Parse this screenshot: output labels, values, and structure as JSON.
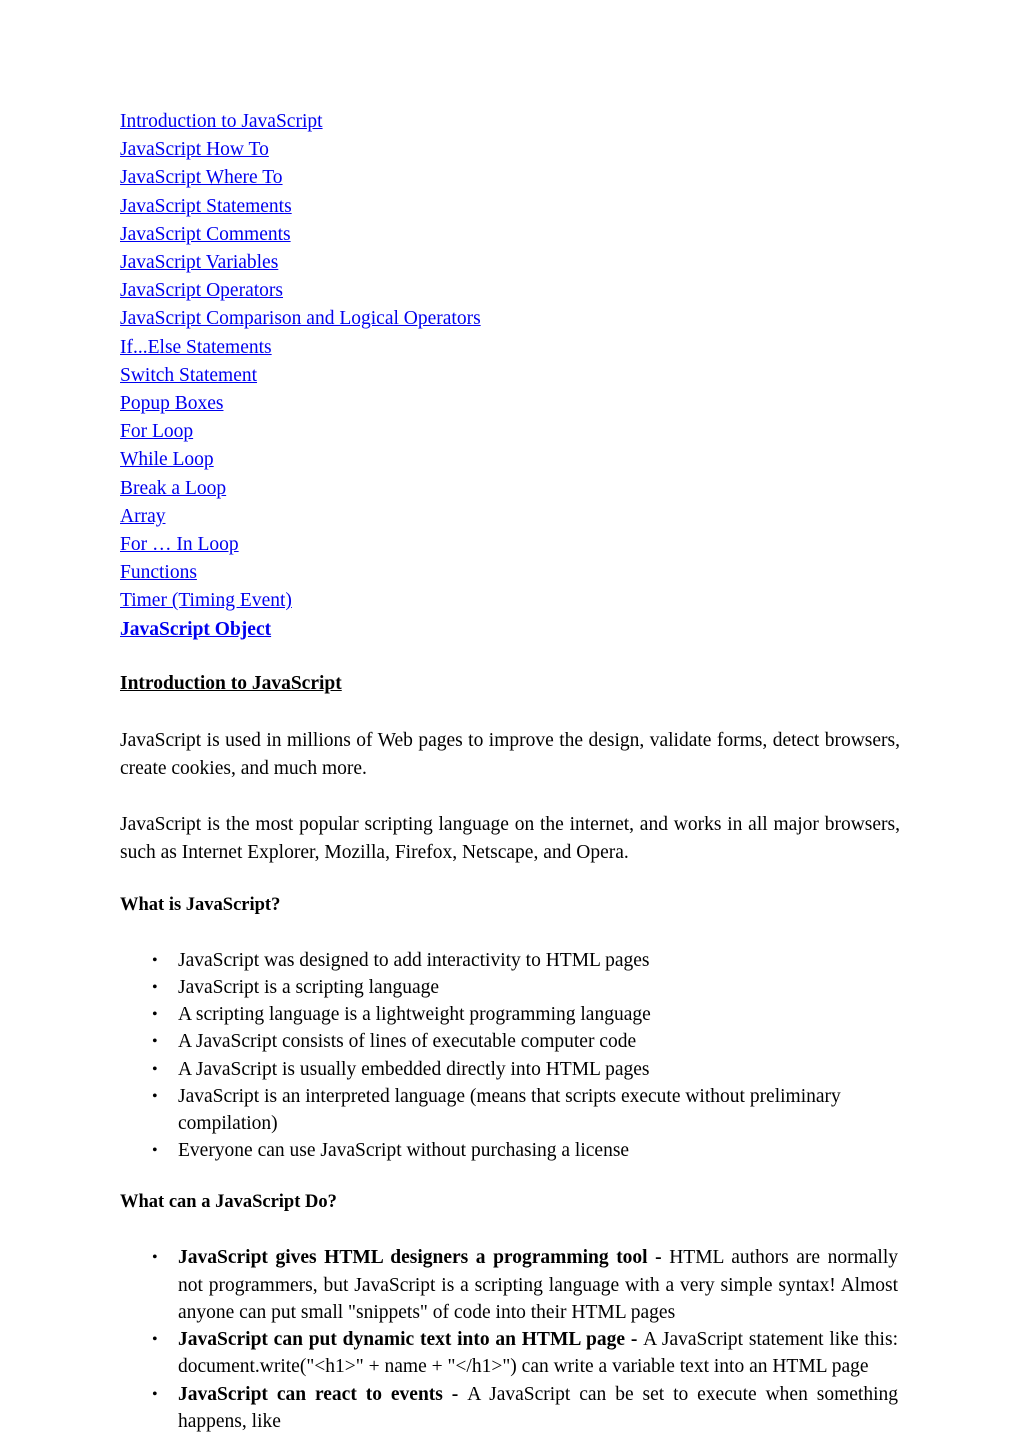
{
  "document": {
    "title": "Introduction to JavaScript"
  },
  "toc": {
    "items": [
      {
        "label": "Introduction to JavaScript",
        "bold": false
      },
      {
        "label": "JavaScript How To",
        "bold": false
      },
      {
        "label": "JavaScript Where To",
        "bold": false
      },
      {
        "label": "JavaScript Statements",
        "bold": false
      },
      {
        "label": "JavaScript Comments",
        "bold": false
      },
      {
        "label": "JavaScript Variables",
        "bold": false
      },
      {
        "label": "JavaScript Operators",
        "bold": false
      },
      {
        "label": "JavaScript Comparison and Logical Operators",
        "bold": false
      },
      {
        "label": "If...Else Statements",
        "bold": false
      },
      {
        "label": "Switch Statement",
        "bold": false
      },
      {
        "label": "Popup Boxes",
        "bold": false
      },
      {
        "label": "For Loop",
        "bold": false
      },
      {
        "label": "While Loop",
        "bold": false
      },
      {
        "label": "Break a Loop",
        "bold": false
      },
      {
        "label": "Array",
        "bold": false
      },
      {
        "label": "For … In Loop",
        "bold": false
      },
      {
        "label": "Functions",
        "bold": false
      },
      {
        "label": "Timer (Timing Event)",
        "bold": false
      },
      {
        "label": "JavaScript Object",
        "bold": true
      }
    ],
    "link_color": "#0000EE"
  },
  "main": {
    "heading": "Introduction to JavaScript",
    "paragraphs": [
      "JavaScript is used in millions of Web pages to improve the design, validate forms, detect browsers, create cookies, and much more.",
      "JavaScript is the most popular scripting language on the internet, and works in all major browsers, such as Internet Explorer, Mozilla, Firefox, Netscape, and Opera."
    ],
    "sections": [
      {
        "heading": "What is JavaScript?",
        "bullets": [
          {
            "lead": "",
            "text": "JavaScript was designed to add interactivity to HTML pages"
          },
          {
            "lead": "",
            "text": "JavaScript is a scripting language"
          },
          {
            "lead": "",
            "text": "A scripting language is a lightweight programming language"
          },
          {
            "lead": "",
            "text": "A JavaScript consists of lines of executable computer code"
          },
          {
            "lead": "",
            "text": "A JavaScript is usually embedded directly into HTML pages"
          },
          {
            "lead": "",
            "text": "JavaScript is an interpreted language (means that scripts execute without preliminary compilation)"
          },
          {
            "lead": "",
            "text": "Everyone can use JavaScript without purchasing a license"
          }
        ]
      },
      {
        "heading": "What can a JavaScript Do?",
        "bullets": [
          {
            "lead": "JavaScript gives HTML designers a programming tool - ",
            "text": "HTML authors are normally not programmers, but JavaScript is a scripting language with a very simple syntax! Almost anyone can put small \"snippets\" of code into their HTML pages"
          },
          {
            "lead": "JavaScript can put dynamic text into an HTML page - ",
            "text": "A JavaScript statement like this: document.write(\"<h1>\" + name + \"</h1>\") can write a variable text into an HTML page"
          },
          {
            "lead": "JavaScript can react to events - ",
            "text": "A JavaScript can be set to execute when something happens, like"
          }
        ]
      }
    ]
  }
}
